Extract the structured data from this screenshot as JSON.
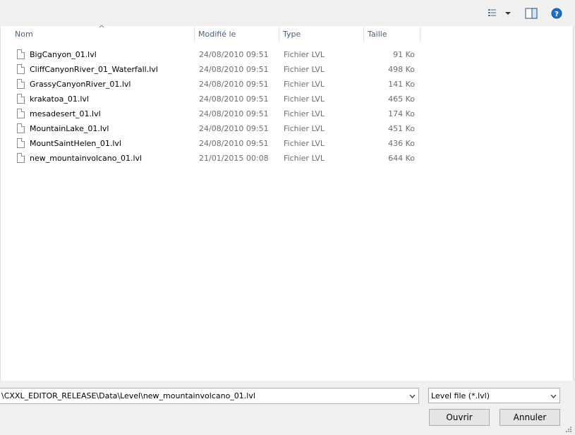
{
  "columns": {
    "name": "Nom",
    "modified": "Modifié le",
    "type": "Type",
    "size": "Taille"
  },
  "files": [
    {
      "name": "BigCanyon_01.lvl",
      "modified": "24/08/2010 09:51",
      "type": "Fichier LVL",
      "size": "91 Ko"
    },
    {
      "name": "CliffCanyonRiver_01_Waterfall.lvl",
      "modified": "24/08/2010 09:51",
      "type": "Fichier LVL",
      "size": "498 Ko"
    },
    {
      "name": "GrassyCanyonRiver_01.lvl",
      "modified": "24/08/2010 09:51",
      "type": "Fichier LVL",
      "size": "141 Ko"
    },
    {
      "name": "krakatoa_01.lvl",
      "modified": "24/08/2010 09:51",
      "type": "Fichier LVL",
      "size": "465 Ko"
    },
    {
      "name": "mesadesert_01.lvl",
      "modified": "24/08/2010 09:51",
      "type": "Fichier LVL",
      "size": "174 Ko"
    },
    {
      "name": "MountainLake_01.lvl",
      "modified": "24/08/2010 09:51",
      "type": "Fichier LVL",
      "size": "451 Ko"
    },
    {
      "name": "MountSaintHelen_01.lvl",
      "modified": "24/08/2010 09:51",
      "type": "Fichier LVL",
      "size": "436 Ko"
    },
    {
      "name": "new_mountainvolcano_01.lvl",
      "modified": "21/01/2015 00:08",
      "type": "Fichier LVL",
      "size": "644 Ko"
    }
  ],
  "filename": {
    "value": "\\CXXL_EDITOR_RELEASE\\Data\\Level\\new_mountainvolcano_01.lvl"
  },
  "filter": {
    "selected": "Level file (*.lvl)"
  },
  "buttons": {
    "open": "Ouvrir",
    "cancel": "Annuler"
  },
  "icons": {
    "view": "view-options-icon",
    "preview": "preview-pane-icon",
    "help": "help-icon",
    "file": "file-icon"
  },
  "colors": {
    "header_text": "#4c607a",
    "help_blue": "#1f6fc5"
  }
}
